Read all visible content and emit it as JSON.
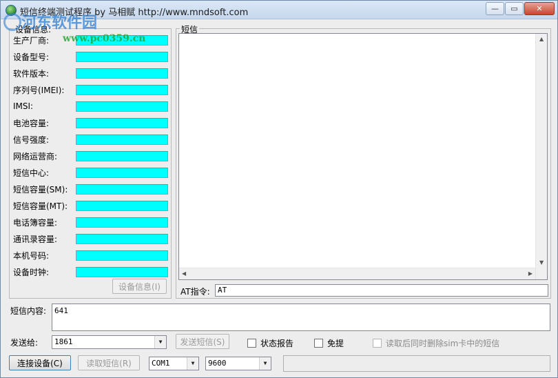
{
  "window": {
    "title": "短信终端测试程序  by 马相赋 http://www.mndsoft.com",
    "watermark_text": "河东软件园",
    "watermark_url": "www.pc0359.cn",
    "buttons": {
      "minimize": "—",
      "maximize": "▭",
      "close": "✕"
    }
  },
  "device_panel": {
    "group_title": "设备信息:",
    "fields": [
      {
        "label": "生产厂商:",
        "value": ""
      },
      {
        "label": "设备型号:",
        "value": ""
      },
      {
        "label": "软件版本:",
        "value": ""
      },
      {
        "label": "序列号(IMEI):",
        "value": ""
      },
      {
        "label": "IMSI:",
        "value": ""
      },
      {
        "label": "电池容量:",
        "value": ""
      },
      {
        "label": "信号强度:",
        "value": ""
      },
      {
        "label": "网络运营商:",
        "value": ""
      },
      {
        "label": "短信中心:",
        "value": ""
      },
      {
        "label": "短信容量(SM):",
        "value": ""
      },
      {
        "label": "短信容量(MT):",
        "value": ""
      },
      {
        "label": "电话簿容量:",
        "value": ""
      },
      {
        "label": "通讯录容量:",
        "value": ""
      },
      {
        "label": "本机号码:",
        "value": ""
      },
      {
        "label": "设备时钟:",
        "value": ""
      }
    ],
    "device_info_button": "设备信息(I)"
  },
  "sms_panel": {
    "group_title": "短信",
    "at_label": "AT指令:",
    "at_value": "AT"
  },
  "compose": {
    "content_label": "短信内容:",
    "content_value": "641",
    "send_to_label": "发送给:",
    "send_to_value": "1861",
    "send_button": "发送短信(S)",
    "status_report_label": "状态报告",
    "status_report_checked": false,
    "free_label": "免提",
    "free_checked": false,
    "delete_after_read_label": "读取后同时删除sim卡中的短信",
    "delete_after_read_checked": false
  },
  "bottom_bar": {
    "connect_button": "连接设备(C)",
    "read_button": "读取短信(R)",
    "port_value": "COM1",
    "baud_value": "9600",
    "status_text": ""
  },
  "colors": {
    "field_bg": "#00ffff",
    "watermark_blue": "#2f7fd3",
    "watermark_green": "#2aa53a"
  }
}
